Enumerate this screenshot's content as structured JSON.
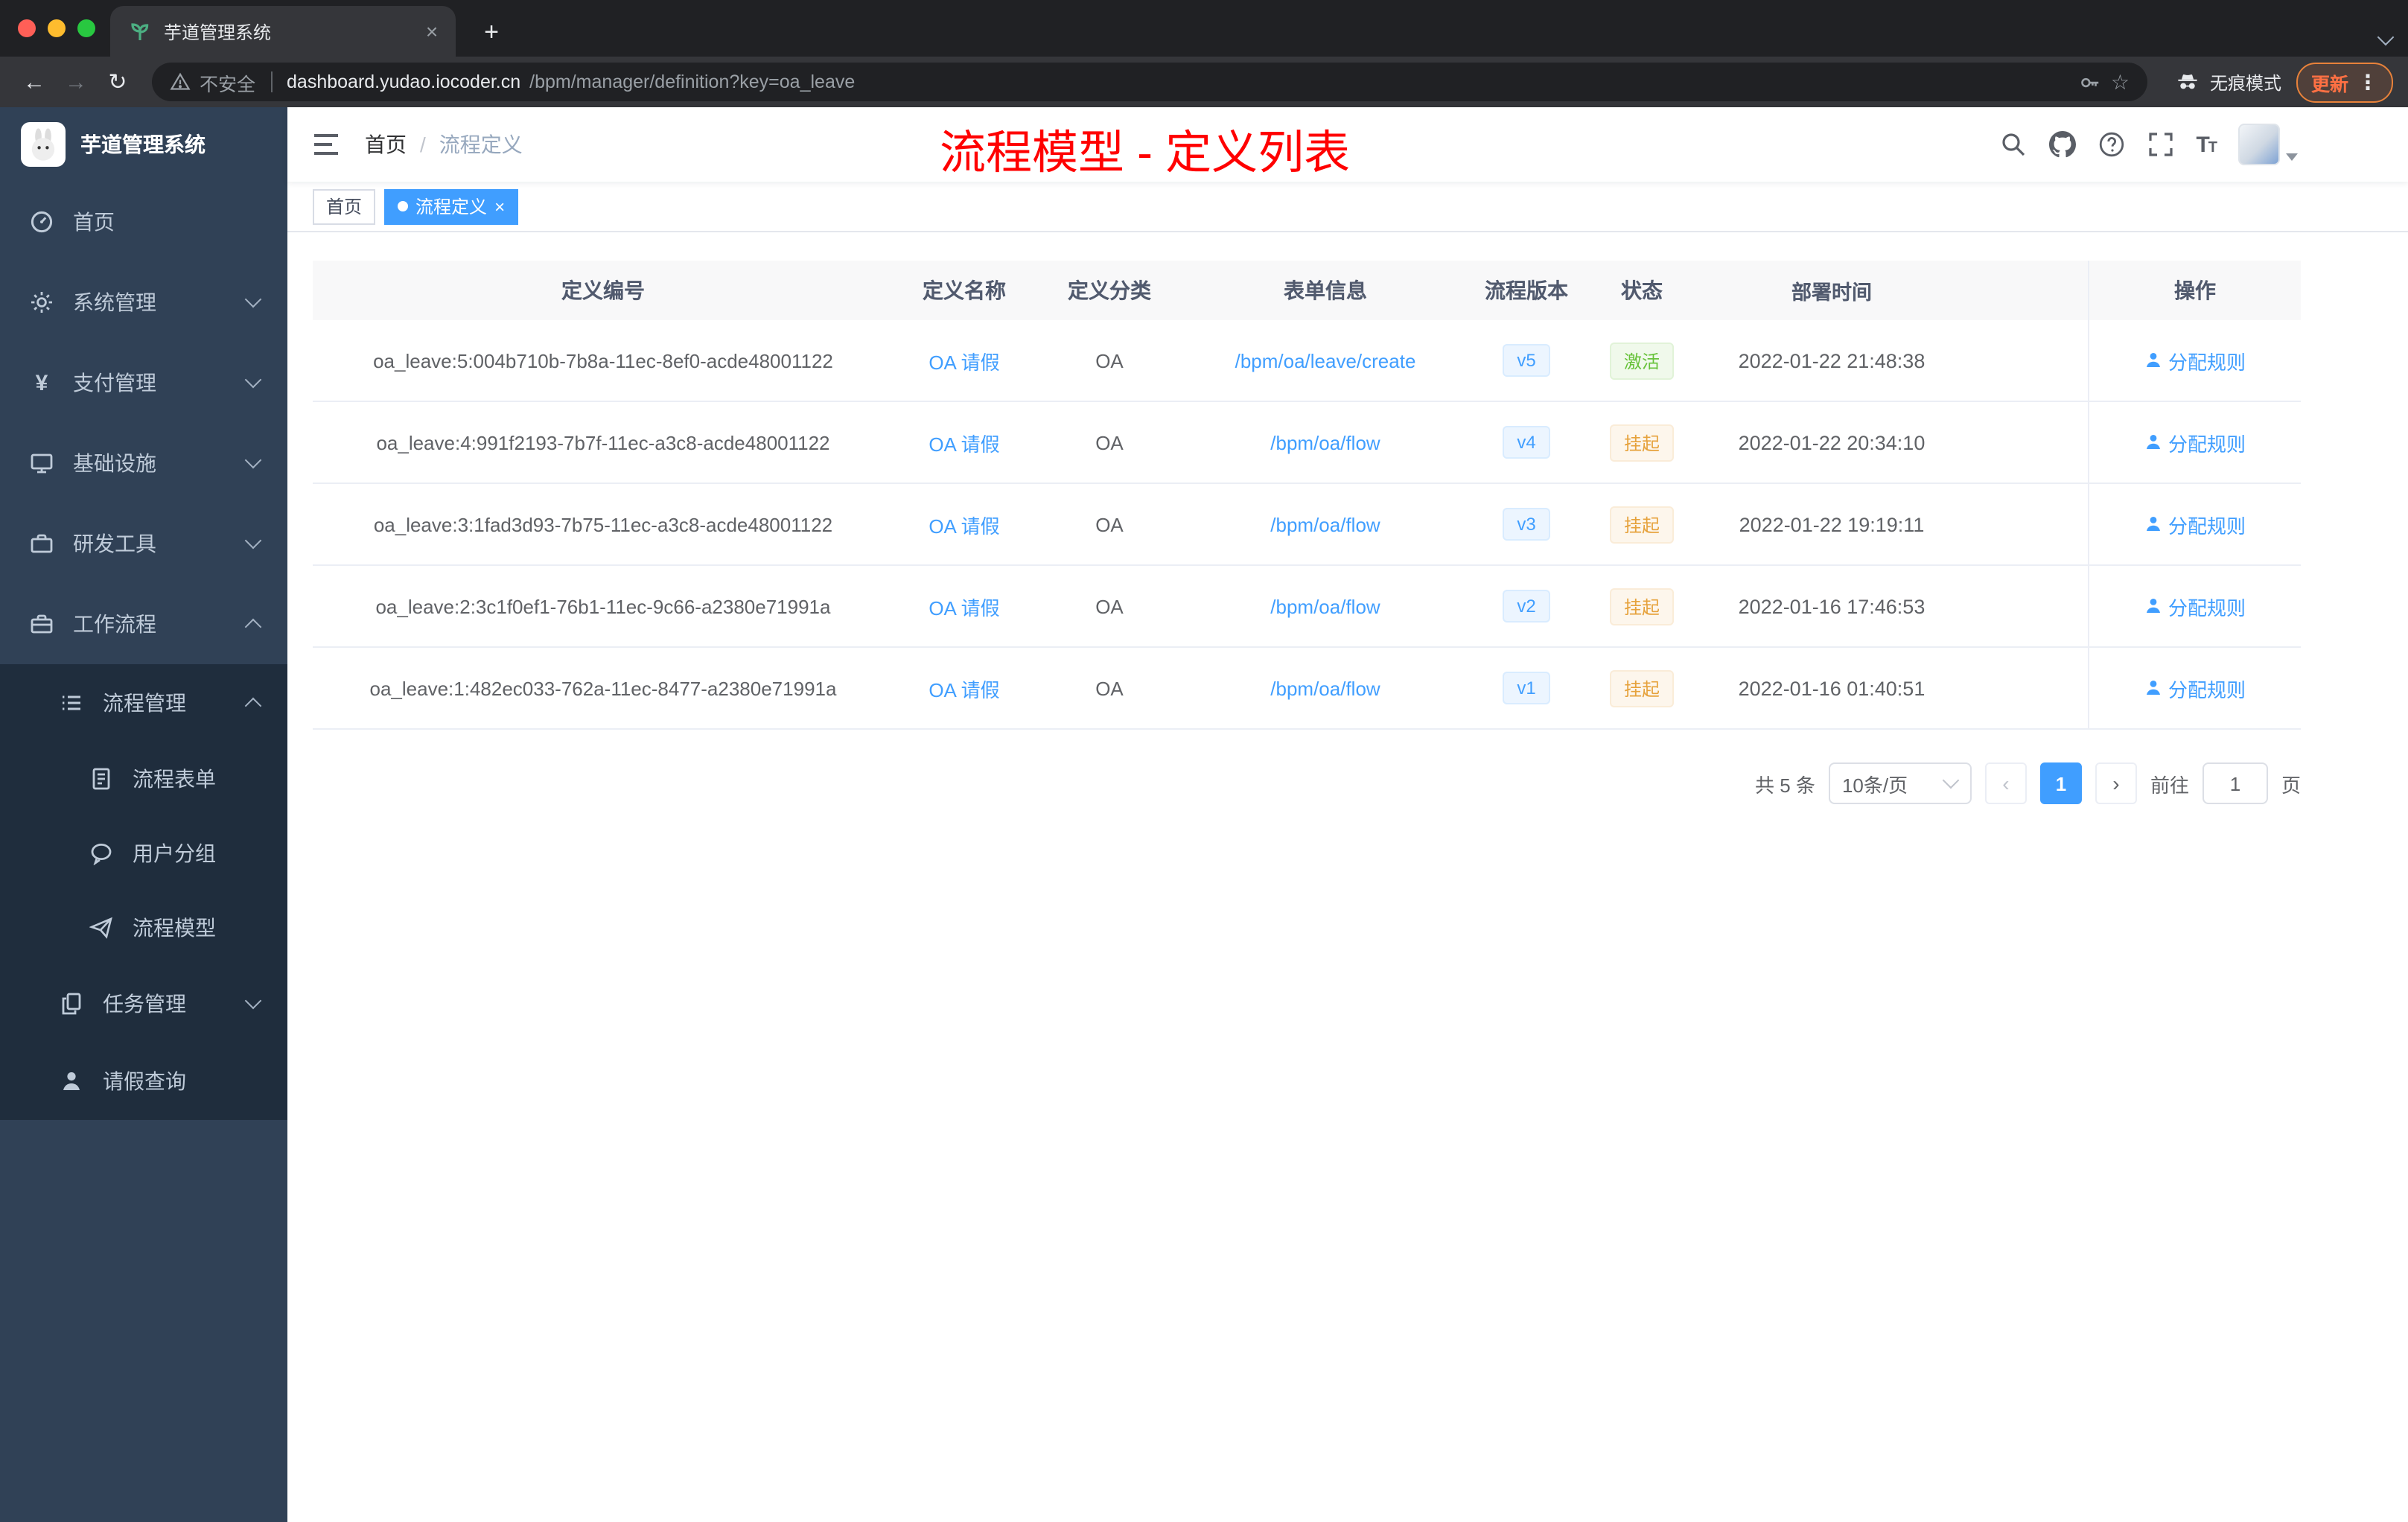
{
  "colors": {
    "accent": "#409EFF",
    "success": "#67C23A",
    "warning": "#E6A23C",
    "annotation": "#FF0000",
    "sidebar_bg": "#304156",
    "submenu_bg": "#1F2D3D"
  },
  "glyphs": {
    "back": "←",
    "forward": "→",
    "reload": "↻",
    "star": "☆",
    "kebab": "⋮",
    "close": "×",
    "plus": "+",
    "slash": "/",
    "prev": "‹",
    "next": "›"
  },
  "browser": {
    "tab_title": "芋道管理系统",
    "security_label": "不安全",
    "url_host": "dashboard.yudao.iocoder.cn",
    "url_path": "/bpm/manager/definition?key=oa_leave",
    "incognito_label": "无痕模式",
    "update_label": "更新"
  },
  "sidebar": {
    "app_title": "芋道管理系统",
    "menu": [
      {
        "label": "首页",
        "icon": "dashboard-icon"
      },
      {
        "label": "系统管理",
        "icon": "gear-icon"
      },
      {
        "label": "支付管理",
        "icon": "yen-icon"
      },
      {
        "label": "基础设施",
        "icon": "monitor-icon"
      },
      {
        "label": "研发工具",
        "icon": "briefcase-icon"
      },
      {
        "label": "工作流程",
        "icon": "briefcase-icon"
      }
    ],
    "submenu": {
      "process_mgmt": {
        "label": "流程管理",
        "icon": "list-icon"
      },
      "children": [
        {
          "label": "流程表单",
          "icon": "form-icon"
        },
        {
          "label": "用户分组",
          "icon": "chat-icon"
        },
        {
          "label": "流程模型",
          "icon": "paper-plane-icon"
        }
      ],
      "task_mgmt": {
        "label": "任务管理",
        "icon": "copy-icon"
      },
      "leave_query": {
        "label": "请假查询",
        "icon": "user-icon"
      }
    }
  },
  "header": {
    "breadcrumb_home": "首页",
    "breadcrumb_current": "流程定义",
    "annotation": "流程模型 - 定义列表"
  },
  "tags": {
    "home": "首页",
    "active": "流程定义"
  },
  "table": {
    "columns": [
      "定义编号",
      "定义名称",
      "定义分类",
      "表单信息",
      "流程版本",
      "状态",
      "部署时间",
      "操作"
    ],
    "rows": [
      {
        "id": "oa_leave:5:004b710b-7b8a-11ec-8ef0-acde48001122",
        "name": "OA 请假",
        "category": "OA",
        "form": "/bpm/oa/leave/create",
        "version": "v5",
        "status": "激活",
        "status_type": "success",
        "time": "2022-01-22 21:48:38",
        "action": "分配规则"
      },
      {
        "id": "oa_leave:4:991f2193-7b7f-11ec-a3c8-acde48001122",
        "name": "OA 请假",
        "category": "OA",
        "form": "/bpm/oa/flow",
        "version": "v4",
        "status": "挂起",
        "status_type": "warning",
        "time": "2022-01-22 20:34:10",
        "action": "分配规则"
      },
      {
        "id": "oa_leave:3:1fad3d93-7b75-11ec-a3c8-acde48001122",
        "name": "OA 请假",
        "category": "OA",
        "form": "/bpm/oa/flow",
        "version": "v3",
        "status": "挂起",
        "status_type": "warning",
        "time": "2022-01-22 19:19:11",
        "action": "分配规则"
      },
      {
        "id": "oa_leave:2:3c1f0ef1-76b1-11ec-9c66-a2380e71991a",
        "name": "OA 请假",
        "category": "OA",
        "form": "/bpm/oa/flow",
        "version": "v2",
        "status": "挂起",
        "status_type": "warning",
        "time": "2022-01-16 17:46:53",
        "action": "分配规则"
      },
      {
        "id": "oa_leave:1:482ec033-762a-11ec-8477-a2380e71991a",
        "name": "OA 请假",
        "category": "OA",
        "form": "/bpm/oa/flow",
        "version": "v1",
        "status": "挂起",
        "status_type": "warning",
        "time": "2022-01-16 01:40:51",
        "action": "分配规则"
      }
    ]
  },
  "pagination": {
    "total": "共 5 条",
    "page_size": "10条/页",
    "current_page": "1",
    "goto_label": "前往",
    "goto_value": "1",
    "page_label": "页"
  }
}
